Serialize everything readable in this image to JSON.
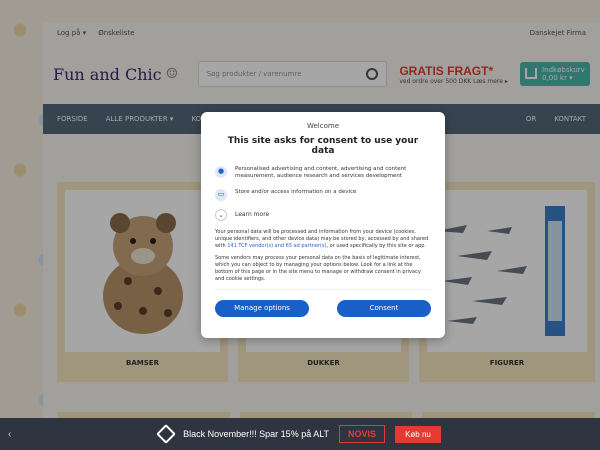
{
  "topbar": {
    "login": "Log på ▾",
    "wishlist": "Ønskeliste",
    "company": "Danskejet Firma"
  },
  "header": {
    "logo": "Fun and Chic",
    "search_placeholder": "Søg produkter / varenumre",
    "promo_big": "GRATIS FRAGT*",
    "promo_small": "ved ordre over 500 DKK  Læs mere ▸",
    "cart_line1": "Indkøbskurv",
    "cart_line2": "0,00 kr ▾"
  },
  "nav": {
    "items": [
      "FORSIDE",
      "ALLE PRODUKTER ▾",
      "KOL"
    ],
    "right": [
      "OR",
      "KONTAKT"
    ]
  },
  "products": [
    {
      "label": "BAMSER"
    },
    {
      "label": "DUKKER"
    },
    {
      "label": "FIGURER"
    }
  ],
  "bottombar": {
    "text": "Black November!!! Spar 15% på ALT",
    "button_outline": "NOVIS",
    "button_red": "Køb nu"
  },
  "modal": {
    "welcome": "Welcome",
    "title": "This site asks for consent to use your data",
    "purpose1": "Personalised advertising and content, advertising and content measurement, audience research and services development",
    "purpose2": "Store and/or access information on a device",
    "learn_more": "Learn more",
    "para1_a": "Your personal data will be processed and information from your device (cookies, unique identifiers, and other device data) may be stored by, accessed by and shared with",
    "para1_link": "141 TCF vendor(s) and 65 ad partner(s)",
    "para1_b": ", or used specifically by this site or app.",
    "para2": "Some vendors may process your personal data on the basis of legitimate interest, which you can object to by managing your options below. Look for a link at the bottom of this page or in the site menu to manage or withdraw consent in privacy and cookie settings.",
    "manage_label": "Manage options",
    "consent_label": "Consent"
  }
}
